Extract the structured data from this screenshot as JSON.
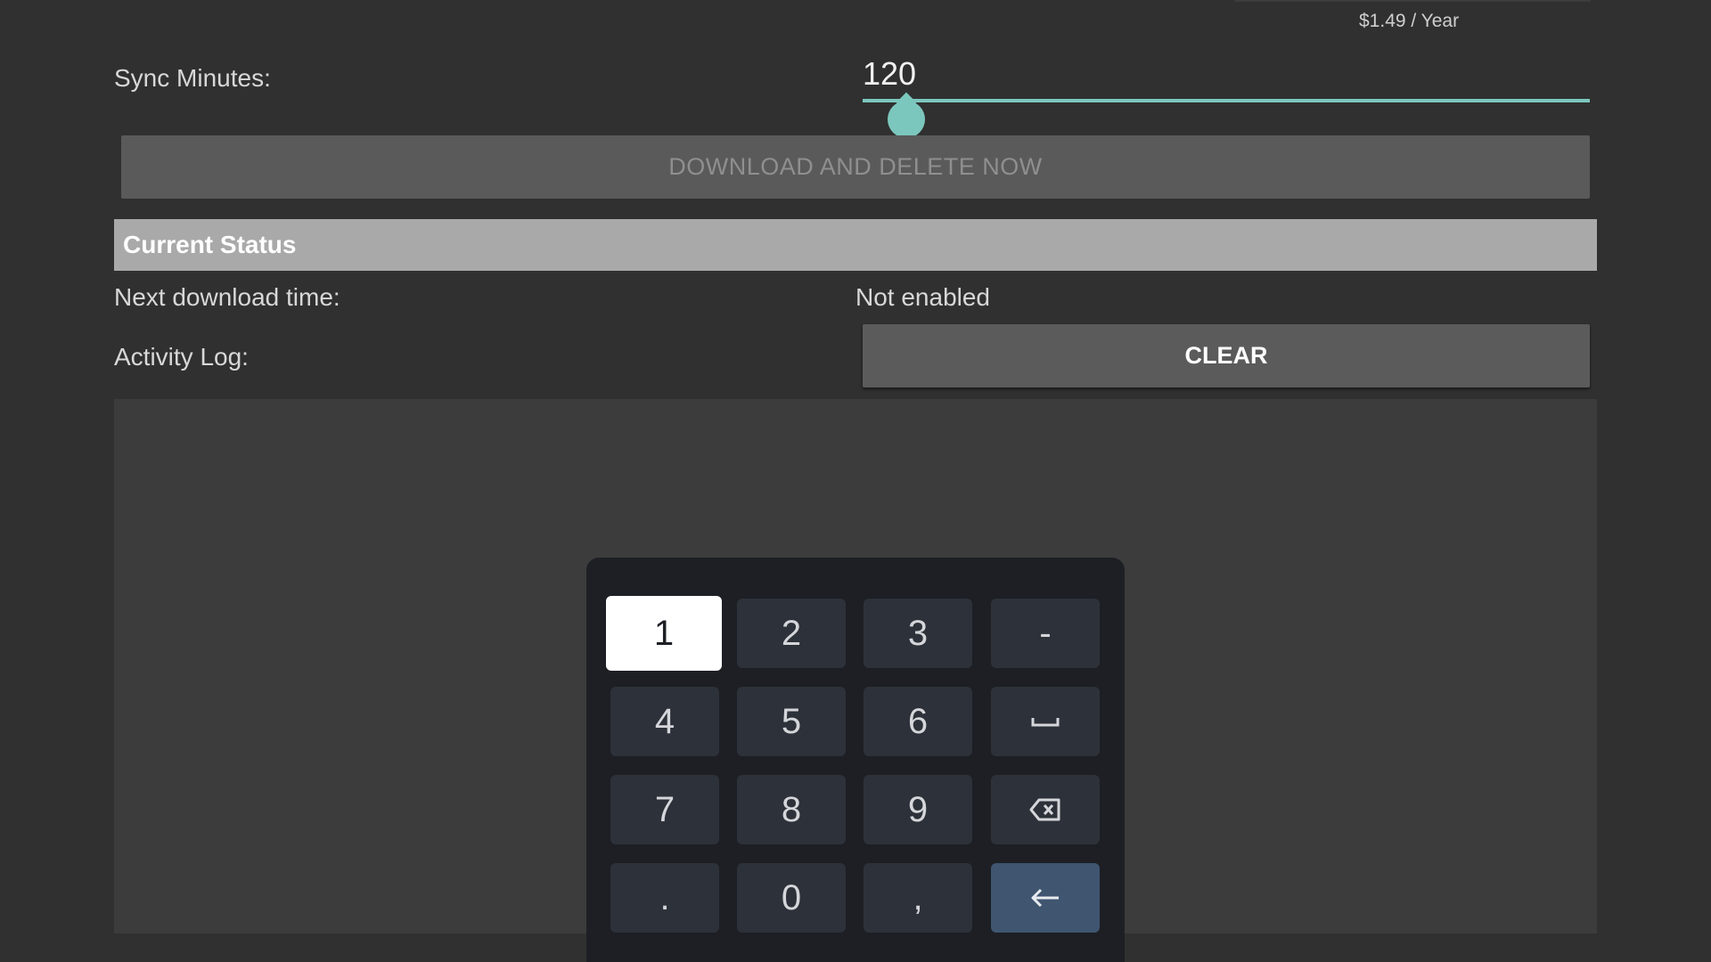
{
  "header": {
    "price": "$1.49 / Year"
  },
  "sync": {
    "label": "Sync Minutes:",
    "value": "120",
    "slider_fraction": 0.06
  },
  "download_button": "DOWNLOAD AND DELETE NOW",
  "status": {
    "title": "Current Status",
    "next_download_label": "Next download time:",
    "next_download_value": "Not enabled",
    "activity_log_label": "Activity Log:",
    "clear_label": "CLEAR"
  },
  "keypad": {
    "row1": [
      "1",
      "2",
      "3",
      "-"
    ],
    "row2": [
      "4",
      "5",
      "6"
    ],
    "row3": [
      "7",
      "8",
      "9"
    ],
    "row4": [
      ".",
      "0",
      ","
    ],
    "icons": {
      "space": "space-icon",
      "backspace": "backspace-icon",
      "enter": "enter-icon"
    },
    "focused_key": "1"
  },
  "colors": {
    "background": "#303030",
    "accent": "#7cc7bd",
    "header_bar": "#a9a9a9",
    "keypad_bg": "#1d1f24",
    "key_bg": "#2d3139",
    "enter_key": "#3f5570"
  }
}
